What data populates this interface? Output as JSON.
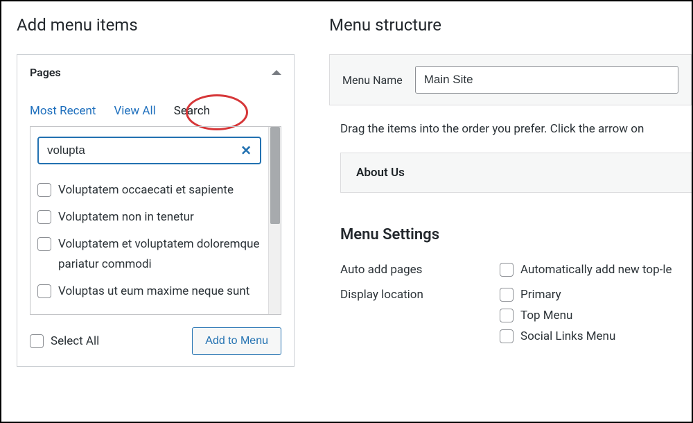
{
  "left": {
    "title": "Add menu items",
    "accordion": {
      "title": "Pages",
      "tabs": {
        "most_recent": "Most Recent",
        "view_all": "View All",
        "search": "Search"
      },
      "search_value": "volupta",
      "results": [
        "Voluptatem occaecati et sapiente",
        "Voluptatem non in tenetur",
        "Voluptatem et voluptatem doloremque pariatur commodi",
        "Voluptas ut eum maxime neque sunt"
      ],
      "select_all": "Select All",
      "add_button": "Add to Menu"
    }
  },
  "right": {
    "title": "Menu structure",
    "menu_name_label": "Menu Name",
    "menu_name_value": "Main Site",
    "drag_hint": "Drag the items into the order you prefer. Click the arrow on",
    "menu_items": [
      "About Us"
    ],
    "settings": {
      "heading": "Menu Settings",
      "auto_add_label": "Auto add pages",
      "auto_add_option": "Automatically add new top-le",
      "display_label": "Display location",
      "locations": [
        "Primary",
        "Top Menu",
        "Social Links Menu"
      ]
    }
  }
}
